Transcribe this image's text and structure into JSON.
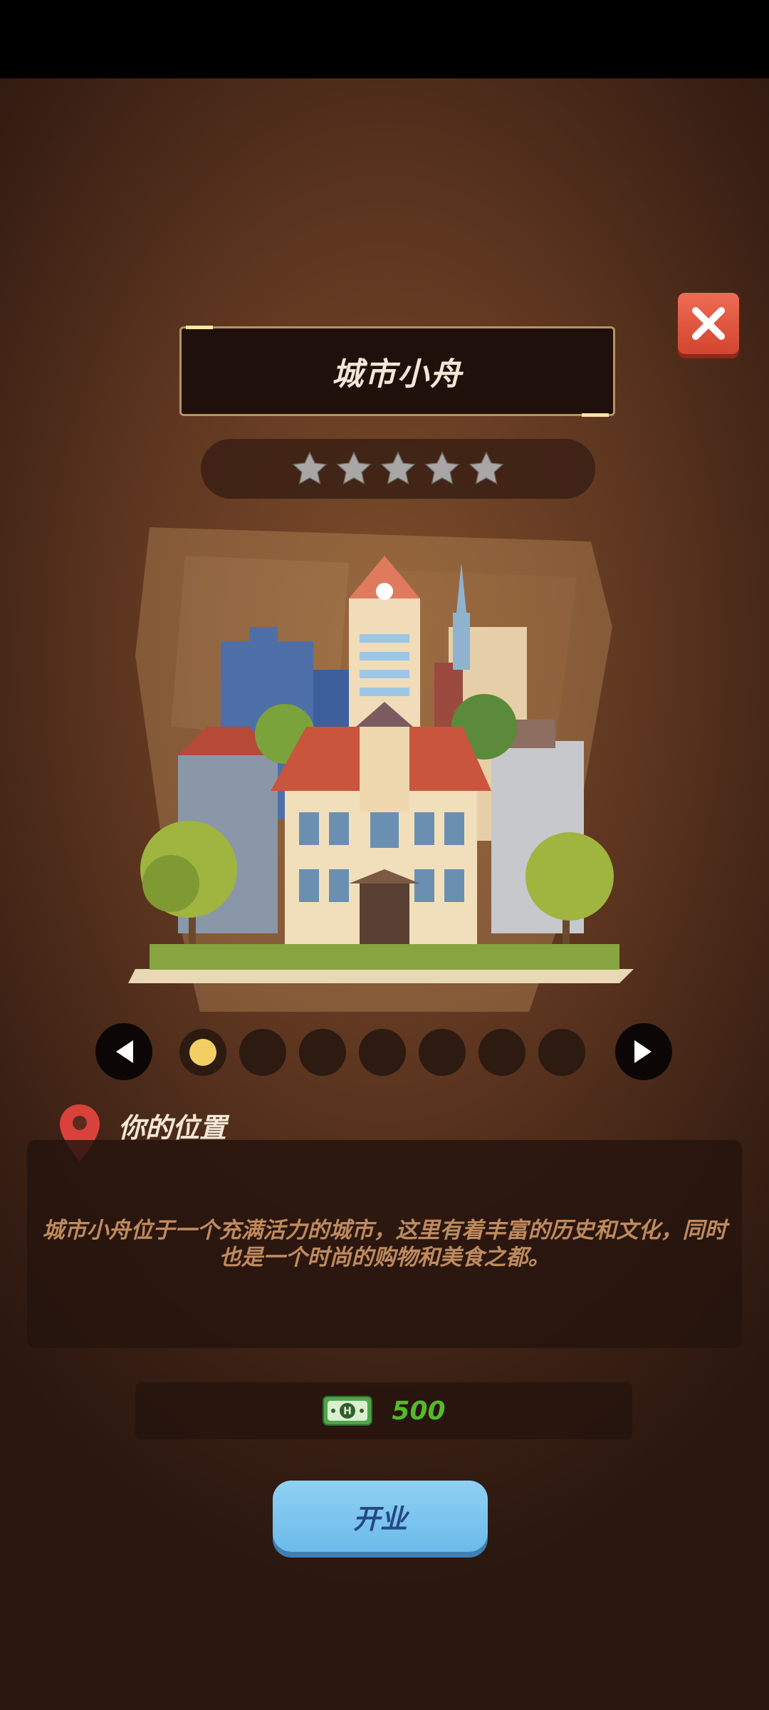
{
  "title": "城市小舟",
  "rating": {
    "stars_total": 5,
    "stars_filled": 0
  },
  "carousel": {
    "total": 7,
    "active_index": 0
  },
  "location": {
    "heading": "你的位置",
    "description": "城市小舟位于一个充满活力的城市，这里有着丰富的历史和文化，同时也是一个时尚的购物和美食之都。"
  },
  "cost": {
    "value": "500",
    "icon": "cash-icon"
  },
  "open_button": {
    "label": "开业"
  },
  "colors": {
    "accent": "#f3cf63",
    "cost": "#55b92c",
    "button": "#7ac6ef",
    "close": "#e05a43"
  }
}
